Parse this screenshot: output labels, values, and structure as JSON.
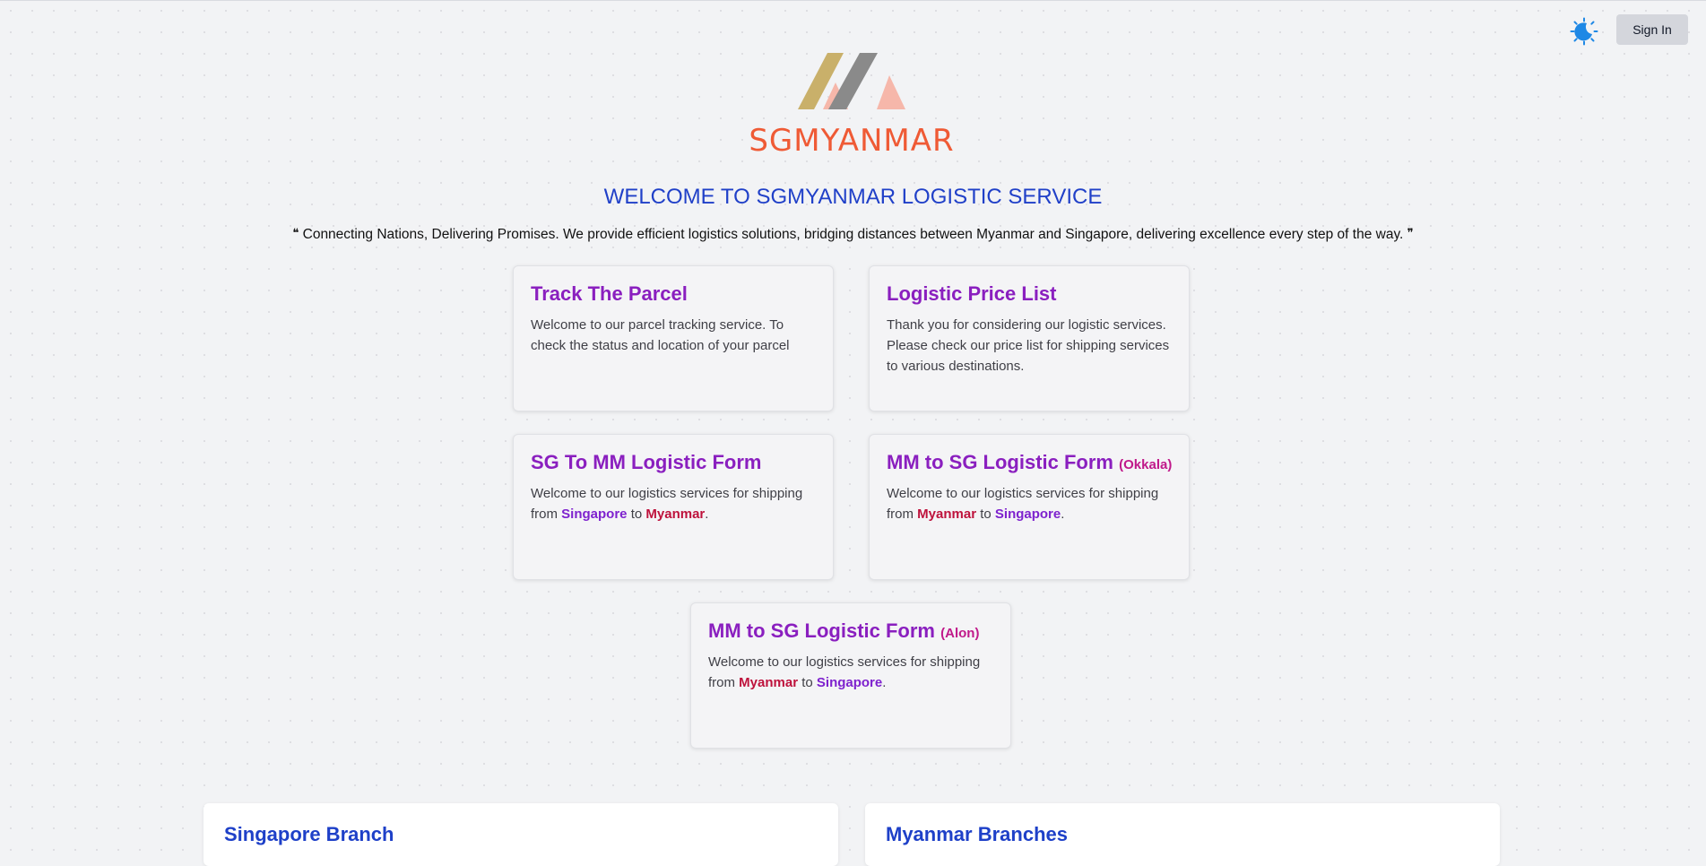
{
  "header": {
    "theme_icon": "moon-sun-icon",
    "signin_label": "Sign In"
  },
  "brand": {
    "name": "SGMYANMAR",
    "colors": {
      "gold": "#c9b06a",
      "gray": "#8a8a8a",
      "pink": "#f6b7aa",
      "orange": "#ef5a35"
    }
  },
  "hero": {
    "title": "WELCOME TO SGMYANMAR LOGISTIC SERVICE",
    "open_quote": "❝",
    "tagline": "Connecting Nations, Delivering Promises. We provide efficient logistics solutions, bridging distances between Myanmar and Singapore, delivering excellence every step of the way.",
    "close_quote": "❞"
  },
  "cards": {
    "track": {
      "title": "Track The Parcel",
      "description": "Welcome to our parcel tracking service. To check the status and location of your parcel"
    },
    "price": {
      "title": "Logistic Price List",
      "description": "Thank you for considering our logistic services. Please check our price list for shipping services to various destinations."
    },
    "sg_mm": {
      "title": "SG To MM Logistic Form",
      "desc_prefix": "Welcome to our logistics services for shipping from ",
      "from": "Singapore",
      "to_word": " to ",
      "to": "Myanmar",
      "end": "."
    },
    "mm_sg_okkala": {
      "title": "MM to SG Logistic Form",
      "location": "(Okkala)",
      "desc_prefix": "Welcome to our logistics services for shipping from ",
      "from": "Myanmar",
      "to_word": " to ",
      "to": "Singapore",
      "end": "."
    },
    "mm_sg_alon": {
      "title": "MM to SG Logistic Form",
      "location": "(Alon)",
      "desc_prefix": "Welcome to our logistics services for shipping from ",
      "from": "Myanmar",
      "to_word": " to ",
      "to": "Singapore",
      "end": "."
    }
  },
  "branches": {
    "singapore": "Singapore Branch",
    "myanmar": "Myanmar Branches"
  }
}
